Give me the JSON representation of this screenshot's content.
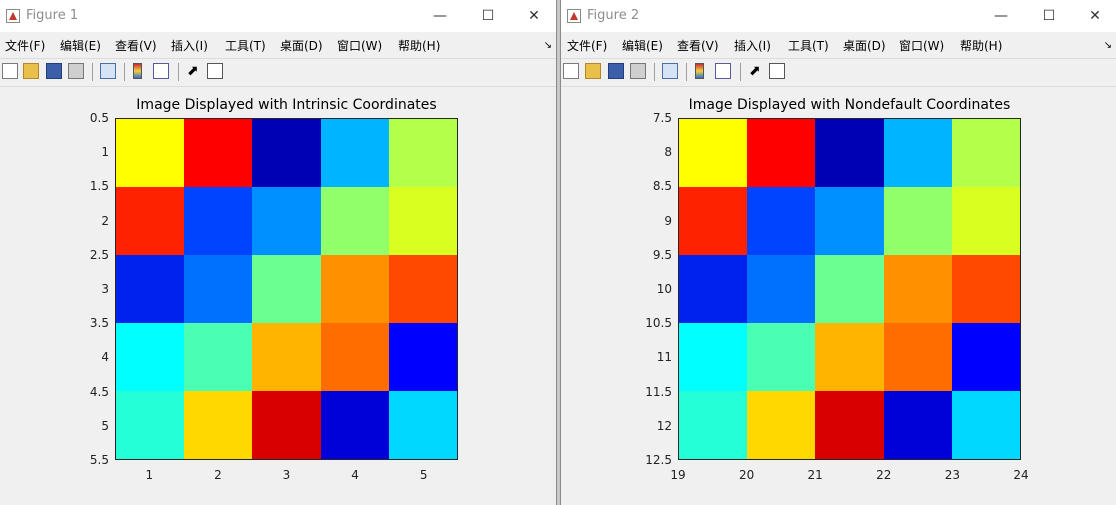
{
  "menu": [
    "文件(F)",
    "编辑(E)",
    "查看(V)",
    "插入(I)",
    "工具(T)",
    "桌面(D)",
    "窗口(W)",
    "帮助(H)"
  ],
  "toolbar_icons": [
    "new-figure-icon",
    "open-icon",
    "save-icon",
    "print-icon",
    "link-plot-icon",
    "colorbar-icon",
    "legend-icon",
    "pointer-icon",
    "property-editor-icon"
  ],
  "window_controls": {
    "minimize": "—",
    "maximize": "☐",
    "close": "✕"
  },
  "colormap": "jet",
  "figures": [
    {
      "window_title": "Figure 1",
      "chart_data": {
        "type": "heatmap",
        "title": "Image Displayed with Intrinsic Coordinates",
        "x_ticks": [
          "1",
          "2",
          "3",
          "4",
          "5"
        ],
        "y_ticks": [
          "0.5",
          "1",
          "1.5",
          "2",
          "2.5",
          "3",
          "3.5",
          "4",
          "4.5",
          "5",
          "5.5"
        ],
        "xlim": [
          0.5,
          5.5
        ],
        "ylim": [
          0.5,
          5.5
        ],
        "cells": [
          [
            "#ffff00",
            "#ff0000",
            "#0000b4",
            "#00b4ff",
            "#b4ff4a"
          ],
          [
            "#ff2200",
            "#0044ff",
            "#0090ff",
            "#90ff6a",
            "#d8ff20"
          ],
          [
            "#0022ee",
            "#0070ff",
            "#6aff90",
            "#ff9000",
            "#ff4800"
          ],
          [
            "#00ffff",
            "#4affb4",
            "#ffb400",
            "#ff6c00",
            "#0000ff"
          ],
          [
            "#24ffd8",
            "#ffd800",
            "#d80000",
            "#0000d8",
            "#00d8ff"
          ]
        ]
      }
    },
    {
      "window_title": "Figure 2",
      "chart_data": {
        "type": "heatmap",
        "title": "Image Displayed with Nondefault Coordinates",
        "x_ticks": [
          "19",
          "20",
          "21",
          "22",
          "23",
          "24"
        ],
        "y_ticks": [
          "7.5",
          "8",
          "8.5",
          "9",
          "9.5",
          "10",
          "10.5",
          "11",
          "11.5",
          "12",
          "12.5"
        ],
        "xlim": [
          19,
          24
        ],
        "ylim": [
          7.5,
          12.5
        ],
        "cells": [
          [
            "#ffff00",
            "#ff0000",
            "#0000b4",
            "#00b4ff",
            "#b4ff4a"
          ],
          [
            "#ff2200",
            "#0044ff",
            "#0090ff",
            "#90ff6a",
            "#d8ff20"
          ],
          [
            "#0022ee",
            "#0070ff",
            "#6aff90",
            "#ff9000",
            "#ff4800"
          ],
          [
            "#00ffff",
            "#4affb4",
            "#ffb400",
            "#ff6c00",
            "#0000ff"
          ],
          [
            "#24ffd8",
            "#ffd800",
            "#d80000",
            "#0000d8",
            "#00d8ff"
          ]
        ]
      }
    }
  ]
}
